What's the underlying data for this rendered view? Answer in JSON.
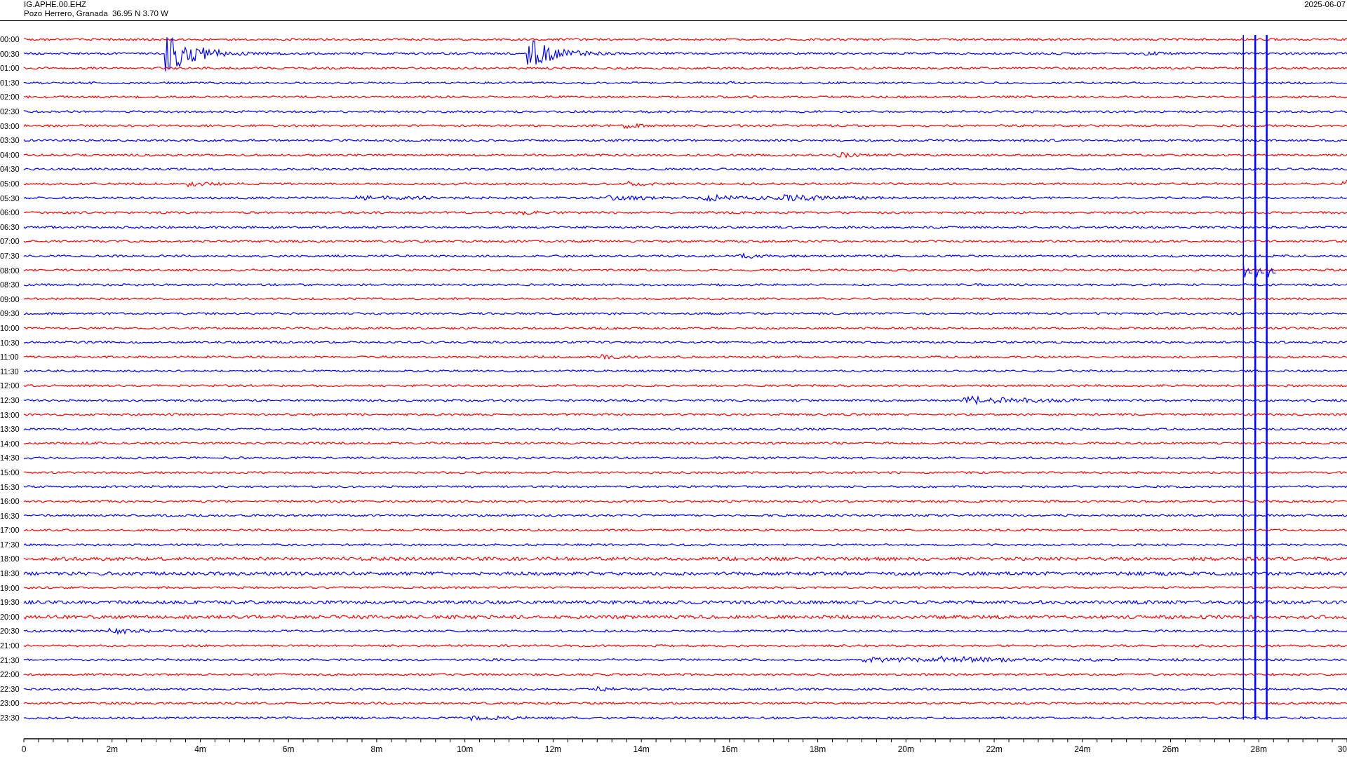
{
  "header": {
    "station": "IG.APHE.00.EHZ",
    "location": "Pozo Herrero, Granada  36.95 N 3.70 W",
    "date": "2025-06-07"
  },
  "traces": [
    {
      "time": "00:00",
      "color": "#ff0000"
    },
    {
      "time": "00:30",
      "color": "#0000ff"
    },
    {
      "time": "01:00",
      "color": "#ff0000"
    },
    {
      "time": "01:30",
      "color": "#0000ff"
    },
    {
      "time": "02:00",
      "color": "#ff0000"
    },
    {
      "time": "02:30",
      "color": "#0000ff"
    },
    {
      "time": "03:00",
      "color": "#ff0000"
    },
    {
      "time": "03:30",
      "color": "#0000ff"
    },
    {
      "time": "04:00",
      "color": "#ff0000"
    },
    {
      "time": "04:30",
      "color": "#0000ff"
    },
    {
      "time": "05:00",
      "color": "#ff0000"
    },
    {
      "time": "05:30",
      "color": "#0000ff"
    },
    {
      "time": "06:00",
      "color": "#ff0000"
    },
    {
      "time": "06:30",
      "color": "#0000ff"
    },
    {
      "time": "07:00",
      "color": "#ff0000"
    },
    {
      "time": "07:30",
      "color": "#0000ff"
    },
    {
      "time": "08:00",
      "color": "#ff0000"
    },
    {
      "time": "08:30",
      "color": "#0000ff"
    },
    {
      "time": "09:00",
      "color": "#ff0000"
    },
    {
      "time": "09:30",
      "color": "#0000ff"
    },
    {
      "time": "10:00",
      "color": "#ff0000"
    },
    {
      "time": "10:30",
      "color": "#0000ff"
    },
    {
      "time": "11:00",
      "color": "#ff0000"
    },
    {
      "time": "11:30",
      "color": "#0000ff"
    },
    {
      "time": "12:00",
      "color": "#ff0000"
    },
    {
      "time": "12:30",
      "color": "#0000ff"
    },
    {
      "time": "13:00",
      "color": "#ff0000"
    },
    {
      "time": "13:30",
      "color": "#0000ff"
    },
    {
      "time": "14:00",
      "color": "#ff0000"
    },
    {
      "time": "14:30",
      "color": "#0000ff"
    },
    {
      "time": "15:00",
      "color": "#ff0000"
    },
    {
      "time": "15:30",
      "color": "#0000ff"
    },
    {
      "time": "16:00",
      "color": "#ff0000"
    },
    {
      "time": "16:30",
      "color": "#0000ff"
    },
    {
      "time": "17:00",
      "color": "#ff0000"
    },
    {
      "time": "17:30",
      "color": "#0000ff"
    },
    {
      "time": "18:00",
      "color": "#ff0000"
    },
    {
      "time": "18:30",
      "color": "#0000ff"
    },
    {
      "time": "19:00",
      "color": "#ff0000"
    },
    {
      "time": "19:30",
      "color": "#0000ff"
    },
    {
      "time": "20:00",
      "color": "#ff0000"
    },
    {
      "time": "20:30",
      "color": "#0000ff"
    },
    {
      "time": "21:00",
      "color": "#ff0000"
    },
    {
      "time": "21:30",
      "color": "#0000ff"
    },
    {
      "time": "22:00",
      "color": "#ff0000"
    },
    {
      "time": "22:30",
      "color": "#0000ff"
    },
    {
      "time": "23:00",
      "color": "#ff0000"
    },
    {
      "time": "23:30",
      "color": "#0000ff"
    }
  ],
  "axis": {
    "ticks": [
      "0",
      "2m",
      "4m",
      "6m",
      "8m",
      "10m",
      "12m",
      "14m",
      "16m",
      "18m",
      "20m",
      "22m",
      "24m",
      "26m",
      "28m",
      "30"
    ]
  }
}
